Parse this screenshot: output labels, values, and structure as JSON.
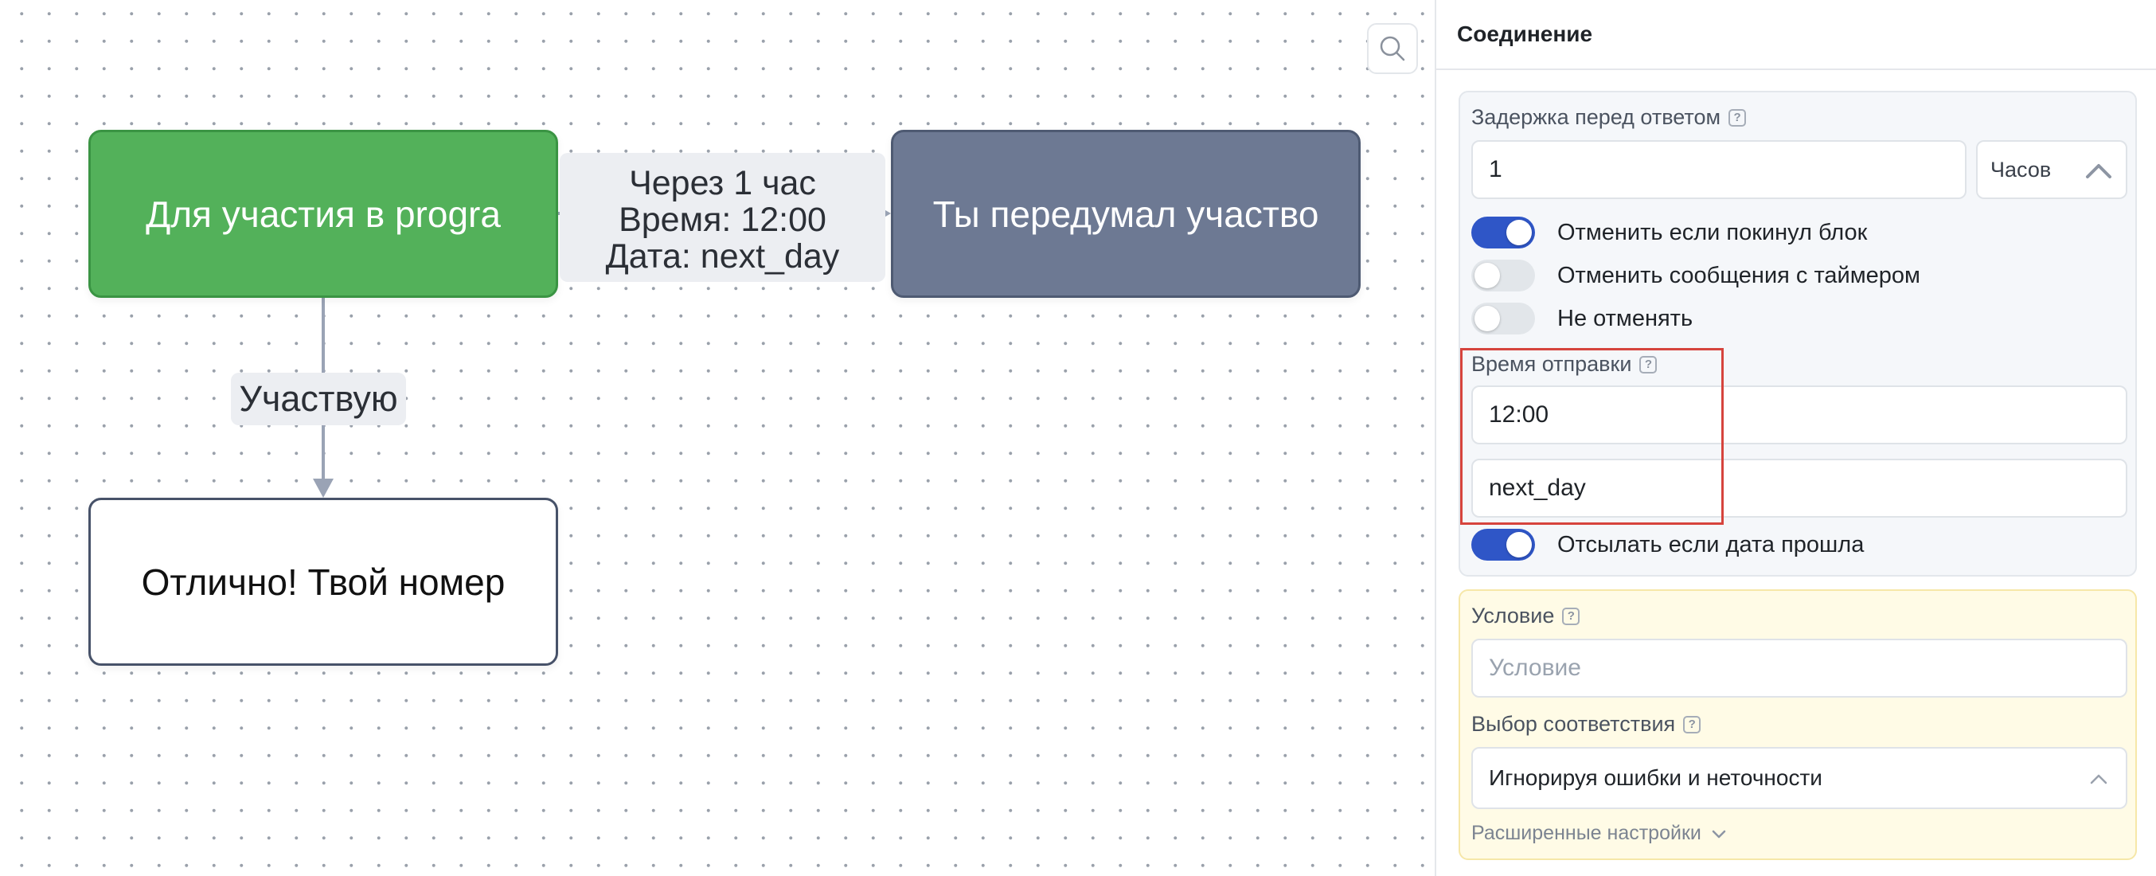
{
  "canvas": {
    "nodes": {
      "start": "Для участия в progra",
      "next": "Ты передумал участво",
      "reply": "Отлично!  Твой номер"
    },
    "edges": {
      "timer": {
        "line1": "Через 1 час",
        "line2": "Время: 12:00",
        "line3": "Дата: next_day"
      },
      "button": "Участвую"
    }
  },
  "panel": {
    "title": "Соединение",
    "delay": {
      "label": "Задержка перед ответом",
      "value": "1",
      "unit": "Часов"
    },
    "toggles": {
      "cancel_if_left": {
        "label": "Отменить если покинул блок",
        "on": true
      },
      "cancel_timer_messages": {
        "label": "Отменить сообщения с таймером",
        "on": false
      },
      "do_not_cancel": {
        "label": "Не отменять",
        "on": false
      },
      "send_if_past": {
        "label": "Отсылать если дата прошла",
        "on": true
      }
    },
    "send_time": {
      "label": "Время отправки",
      "time": "12:00",
      "date": "next_day"
    },
    "condition": {
      "label": "Условие",
      "placeholder": "Условие"
    },
    "match": {
      "label": "Выбор соответствия",
      "value": "Игнорируя ошибки и неточности"
    },
    "advanced_label": "Расширенные настройки",
    "help_glyph": "?"
  },
  "colors": {
    "start_node": "#53b15a",
    "next_node": "#6d7993",
    "toggle_on": "#2f56c7",
    "highlight": "#d6443d",
    "condition_bg": "#fffbe6"
  }
}
